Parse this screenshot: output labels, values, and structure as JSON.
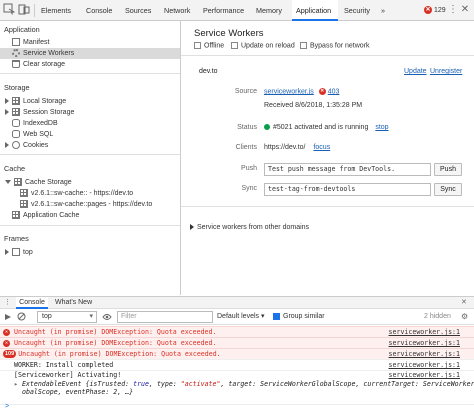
{
  "toolbar": {
    "tabs": [
      "Elements",
      "Console",
      "Sources",
      "Network",
      "Performance",
      "Memory",
      "Application",
      "Security"
    ],
    "more": "»",
    "error_count": "129",
    "menu_icon": "⋮",
    "close_icon": "✕"
  },
  "sidebar": {
    "application_header": "Application",
    "app_items": [
      "Manifest",
      "Service Workers",
      "Clear storage"
    ],
    "storage_header": "Storage",
    "storage_items": [
      "Local Storage",
      "Session Storage",
      "IndexedDB",
      "Web SQL",
      "Cookies"
    ],
    "cache_header": "Cache",
    "cache_storage": "Cache Storage",
    "cache_entries": [
      "v2.6.1::sw-cache:: - https://dev.to",
      "v2.6.1::sw-cache::pages - https://dev.to"
    ],
    "app_cache": "Application Cache",
    "frames_header": "Frames",
    "frame_top": "top"
  },
  "main": {
    "title": "Service Workers",
    "offline": "Offline",
    "update_on_reload": "Update on reload",
    "bypass": "Bypass for network",
    "origin": "dev.to",
    "update_link": "Update",
    "unregister_link": "Unregister",
    "source_label": "Source",
    "source_file": "serviceworker.js",
    "source_status": "403",
    "received": "Received 8/6/2018, 1:35:28 PM",
    "status_label": "Status",
    "status_text": "#5021 activated and is running",
    "stop_link": "stop",
    "clients_label": "Clients",
    "clients_url": "https://dev.to/",
    "focus_link": "focus",
    "push_label": "Push",
    "push_value": "Test push message from DevTools.",
    "push_button": "Push",
    "sync_label": "Sync",
    "sync_value": "test-tag-from-devtools",
    "sync_button": "Sync",
    "other_origins": "Service workers from other domains"
  },
  "drawer": {
    "tabs": [
      "Console",
      "What's New"
    ],
    "context": "top",
    "filter_placeholder": "Filter",
    "levels": "Default levels ▾",
    "group_similar": "Group similar",
    "hidden": "2 hidden"
  },
  "console": {
    "messages": [
      {
        "type": "error",
        "text": "Uncaught (in promise) DOMException: Quota exceeded.",
        "source": "serviceworker.js:1"
      },
      {
        "type": "error",
        "text": "Uncaught (in promise) DOMException: Quota exceeded.",
        "source": "serviceworker.js:1"
      },
      {
        "type": "error",
        "count": "109",
        "text": "Uncaught (in promise) DOMException: Quota exceeded.",
        "source": "serviceworker.js:1"
      },
      {
        "type": "log",
        "text": "WORKER: Install completed",
        "source": "serviceworker.js:1"
      },
      {
        "type": "log",
        "text": "[Serviceworker] Activating!",
        "source": "serviceworker.js:1"
      }
    ],
    "event_line1_prefix": "ExtendableEvent {isTrusted: ",
    "event_true": "true",
    "event_type_key": ", type: ",
    "event_type_val": "\"activate\"",
    "event_rest1": ", target: ServiceWorkerGlobalScope, currentTarget: ServiceWorkerGl",
    "event_line2": "obalScope, eventPhase: 2, …}",
    "prompt": ">"
  }
}
